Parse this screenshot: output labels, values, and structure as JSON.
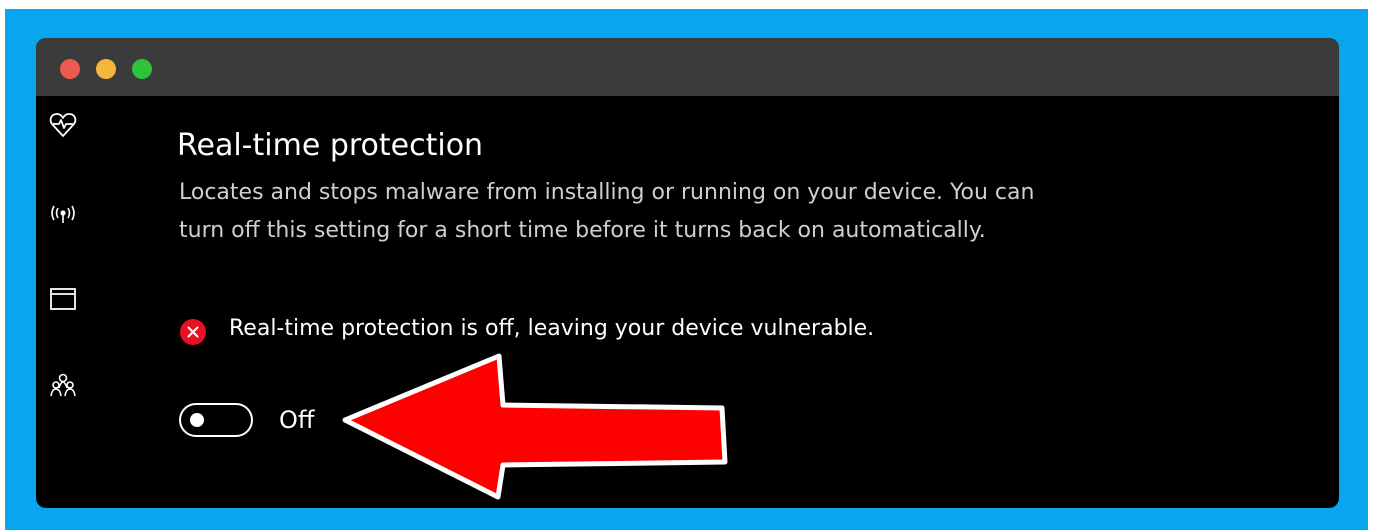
{
  "window": {
    "traffic_lights": [
      "close",
      "minimize",
      "maximize"
    ],
    "colors": {
      "frame": "#08a6ef",
      "titlebar": "#3b3b3b",
      "background": "#000000",
      "close": "#ee5a52",
      "minimize": "#f4b73a",
      "maximize": "#2fc33d"
    }
  },
  "sidebar": {
    "items": [
      {
        "icon": "heart-pulse-icon"
      },
      {
        "icon": "wireless-signal-icon"
      },
      {
        "icon": "browser-window-icon"
      },
      {
        "icon": "family-icon"
      }
    ]
  },
  "section": {
    "title": "Real-time protection",
    "description": "Locates and stops malware from installing or running on your device. You can turn off this setting for a short time before it turns back on automatically."
  },
  "status": {
    "icon": "error-x-icon",
    "text": "Real-time protection is off, leaving your device vulnerable.",
    "color": "#e81123"
  },
  "toggle": {
    "state": "off",
    "label": "Off"
  },
  "annotation": {
    "icon": "red-arrow-icon",
    "color": "#ff0000"
  }
}
